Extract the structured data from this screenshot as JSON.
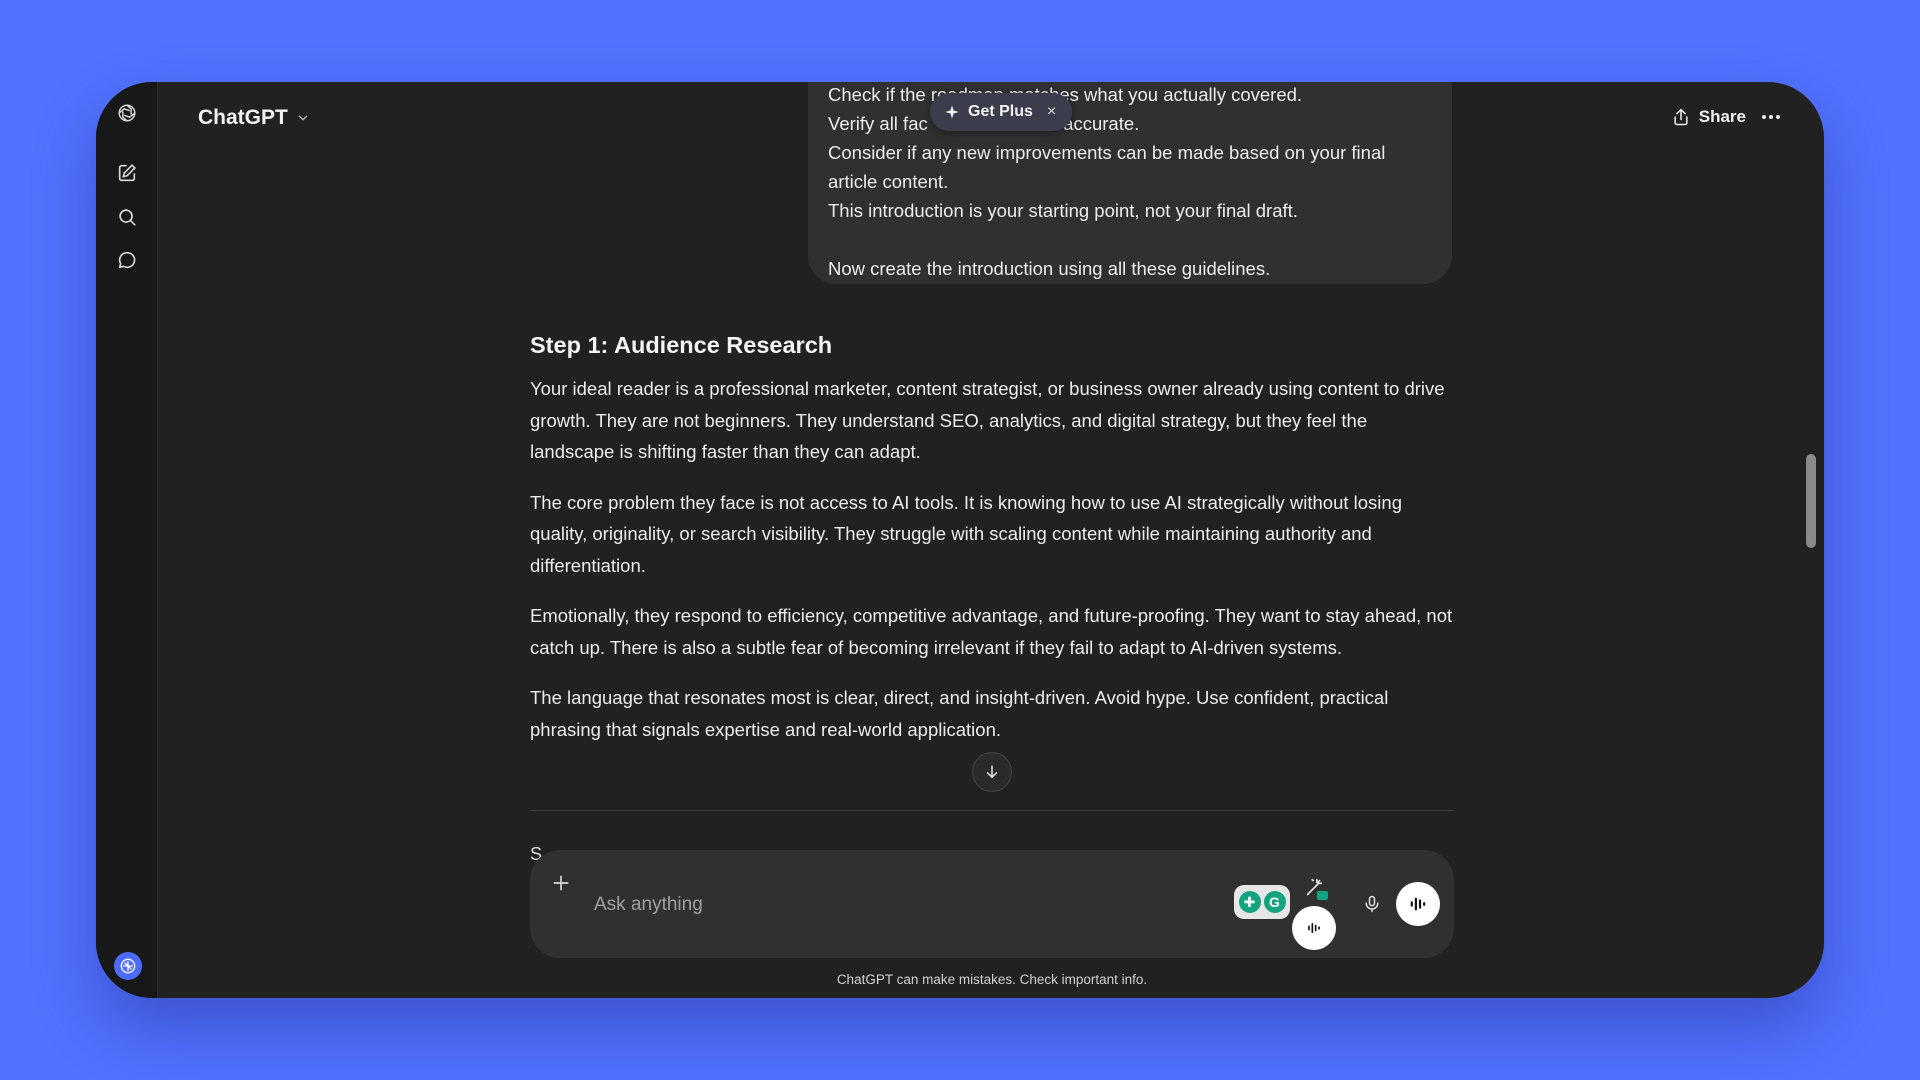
{
  "app": {
    "title": "ChatGPT",
    "share_label": "Share"
  },
  "sidebar": {
    "items": [
      {
        "name": "new-chat",
        "icon": "edit-icon"
      },
      {
        "name": "search",
        "icon": "search-icon"
      },
      {
        "name": "chats",
        "icon": "chat-bubble-icon"
      }
    ]
  },
  "user_message": {
    "lines": [
      "Check if the roadmap matches what you actually covered.",
      "Verify all fac",
      "e accurate.",
      "Consider if any new improvements can be made based on your final",
      "article content.",
      "This introduction is your starting point, not your final draft.",
      "Now create the introduction using all these guidelines."
    ]
  },
  "promo": {
    "label": "Get Plus",
    "close": "×"
  },
  "answer": {
    "heading": "Step 1: Audience Research",
    "paragraphs": [
      "Your ideal reader is a professional marketer, content strategist, or business owner already using content to drive growth. They are not beginners. They understand SEO, analytics, and digital strategy, but they feel the landscape is shifting faster than they can adapt.",
      "The core problem they face is not access to AI tools. It is knowing how to use AI strategically without losing quality, originality, or search visibility. They struggle with scaling content while maintaining authority and differentiation.",
      "Emotionally, they respond to efficiency, competitive advantage, and future-proofing. They want to stay ahead, not catch up. There is also a subtle fear of becoming irrelevant if they fail to adapt to AI-driven systems.",
      "The language that resonates most is clear, direct, and insight-driven. Avoid hype. Use confident, practical phrasing that signals expertise and real-world application."
    ],
    "partial_next": "S"
  },
  "composer": {
    "placeholder": "Ask anything",
    "badge_letters": [
      "✚",
      "G"
    ]
  },
  "footer": {
    "note": "ChatGPT can make mistakes. Check important info."
  },
  "colors": {
    "background": "#5272ff",
    "window": "#212121",
    "bubble": "#303030",
    "accent_green": "#14a37f"
  }
}
